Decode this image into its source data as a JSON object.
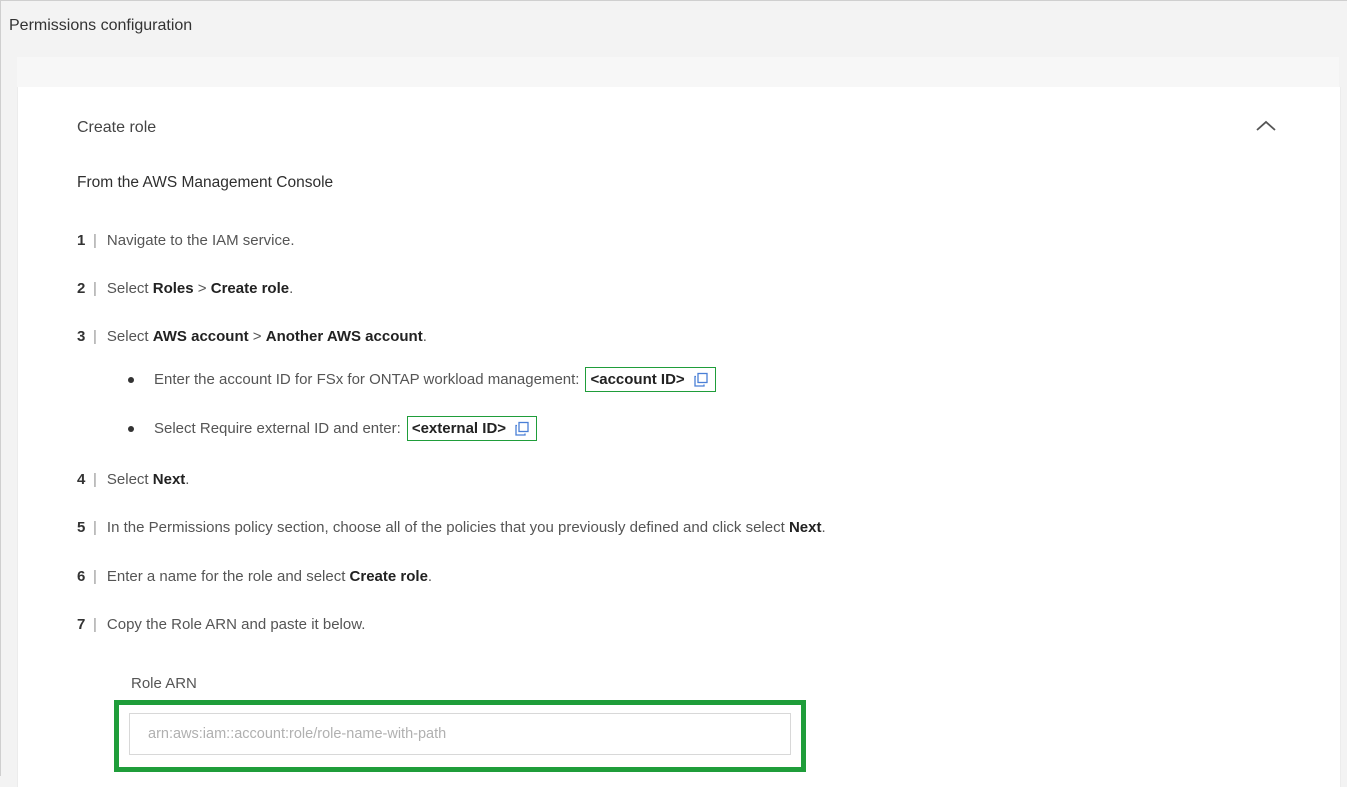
{
  "section": {
    "title": "Permissions configuration"
  },
  "accordion": {
    "title": "Create role",
    "collapse_icon": "chevron-up-icon"
  },
  "subheading": "From the AWS Management Console",
  "steps": [
    {
      "num": "1",
      "parts": [
        "Navigate to the IAM service."
      ]
    },
    {
      "num": "2",
      "pre": "Select ",
      "b1": "Roles",
      "mid": " > ",
      "b2": "Create role",
      "post": "."
    },
    {
      "num": "3",
      "pre": "Select ",
      "b1": "AWS account",
      "mid": " > ",
      "b2": "Another AWS account",
      "post": "."
    },
    {
      "num": "4",
      "pre": "Select ",
      "b1": "Next",
      "post": "."
    },
    {
      "num": "5",
      "pre": "In the Permissions policy section, choose all of the policies that you previously defined and click select ",
      "b1": "Next",
      "post": "."
    },
    {
      "num": "6",
      "pre": "Enter a name for the role and select ",
      "b1": "Create role",
      "post": "."
    },
    {
      "num": "7",
      "pre": "Copy the Role ARN and paste it below."
    }
  ],
  "bullets": [
    {
      "text": "Enter the account ID for FSx for ONTAP workload management:",
      "chip": "<account ID>",
      "icon": "copy-icon"
    },
    {
      "text": "Select Require external ID and enter:",
      "chip": "<external ID>",
      "icon": "copy-icon"
    }
  ],
  "role_arn": {
    "label": "Role ARN",
    "value": "",
    "placeholder": "arn:aws:iam::account:role/role-name-with-path"
  },
  "colors": {
    "highlight": "#1f9d3a",
    "copy_icon": "#4a7fd6"
  }
}
